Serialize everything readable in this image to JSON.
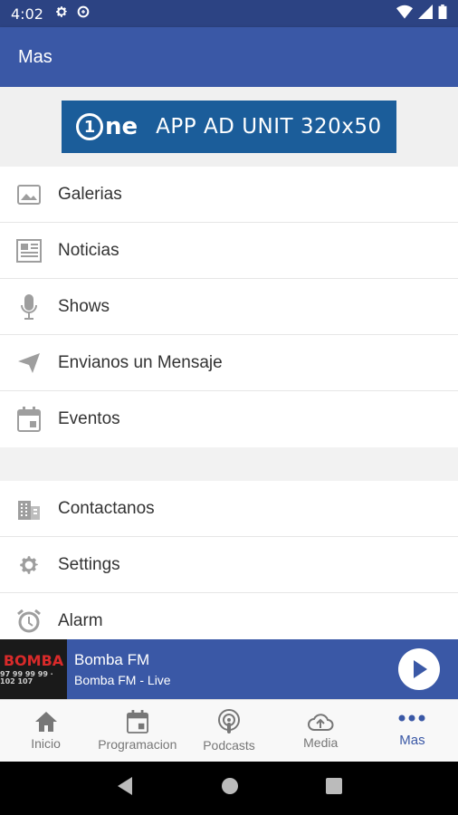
{
  "status_bar": {
    "time": "4:02"
  },
  "header": {
    "title": "Mas"
  },
  "ad": {
    "logo_text": "ne",
    "logo_digit": "1",
    "text": "APP AD UNIT 320x50"
  },
  "menu_group1": [
    {
      "label": "Galerias",
      "icon": "image-icon"
    },
    {
      "label": "Noticias",
      "icon": "newspaper-icon"
    },
    {
      "label": "Shows",
      "icon": "microphone-icon"
    },
    {
      "label": "Envianos un Mensaje",
      "icon": "send-icon"
    },
    {
      "label": "Eventos",
      "icon": "calendar-icon"
    }
  ],
  "menu_group2": [
    {
      "label": "Contactanos",
      "icon": "building-icon"
    },
    {
      "label": "Settings",
      "icon": "gear-icon"
    },
    {
      "label": "Alarm",
      "icon": "alarm-icon"
    }
  ],
  "player": {
    "art_text": "BOMBA",
    "art_sub": "97 99 99 99 · 102 107",
    "title": "Bomba FM",
    "subtitle": "Bomba FM - Live"
  },
  "bottom_nav": [
    {
      "label": "Inicio",
      "icon": "home-icon"
    },
    {
      "label": "Programacion",
      "icon": "calendar-icon"
    },
    {
      "label": "Podcasts",
      "icon": "podcast-icon"
    },
    {
      "label": "Media",
      "icon": "cloud-upload-icon"
    },
    {
      "label": "Mas",
      "icon": "more-icon"
    }
  ],
  "colors": {
    "primary": "#3a58a6",
    "status_bar": "#2c4383",
    "ad_blue": "#1b5d9a"
  }
}
